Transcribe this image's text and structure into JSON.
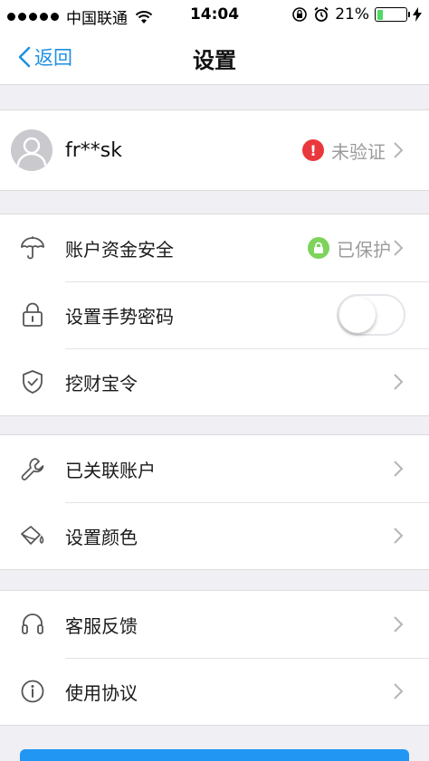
{
  "status_bar": {
    "carrier": "中国联通",
    "time": "14:04",
    "battery": "21%",
    "battery_level": 0.21
  },
  "nav": {
    "back_label": "返回",
    "title": "设置"
  },
  "profile": {
    "name": "fr**sk",
    "status": "未验证"
  },
  "security": {
    "funds_label": "账户资金安全",
    "funds_status": "已保护",
    "gesture_label": "设置手势密码",
    "gesture_enabled": false,
    "token_label": "挖财宝令"
  },
  "accounts": {
    "linked_label": "已关联账户",
    "color_label": "设置颜色"
  },
  "support": {
    "feedback_label": "客服反馈",
    "agreement_label": "使用协议"
  },
  "colors": {
    "accent": "#1e8fe1",
    "alert": "#e9383d",
    "ok": "#7ed35b"
  }
}
